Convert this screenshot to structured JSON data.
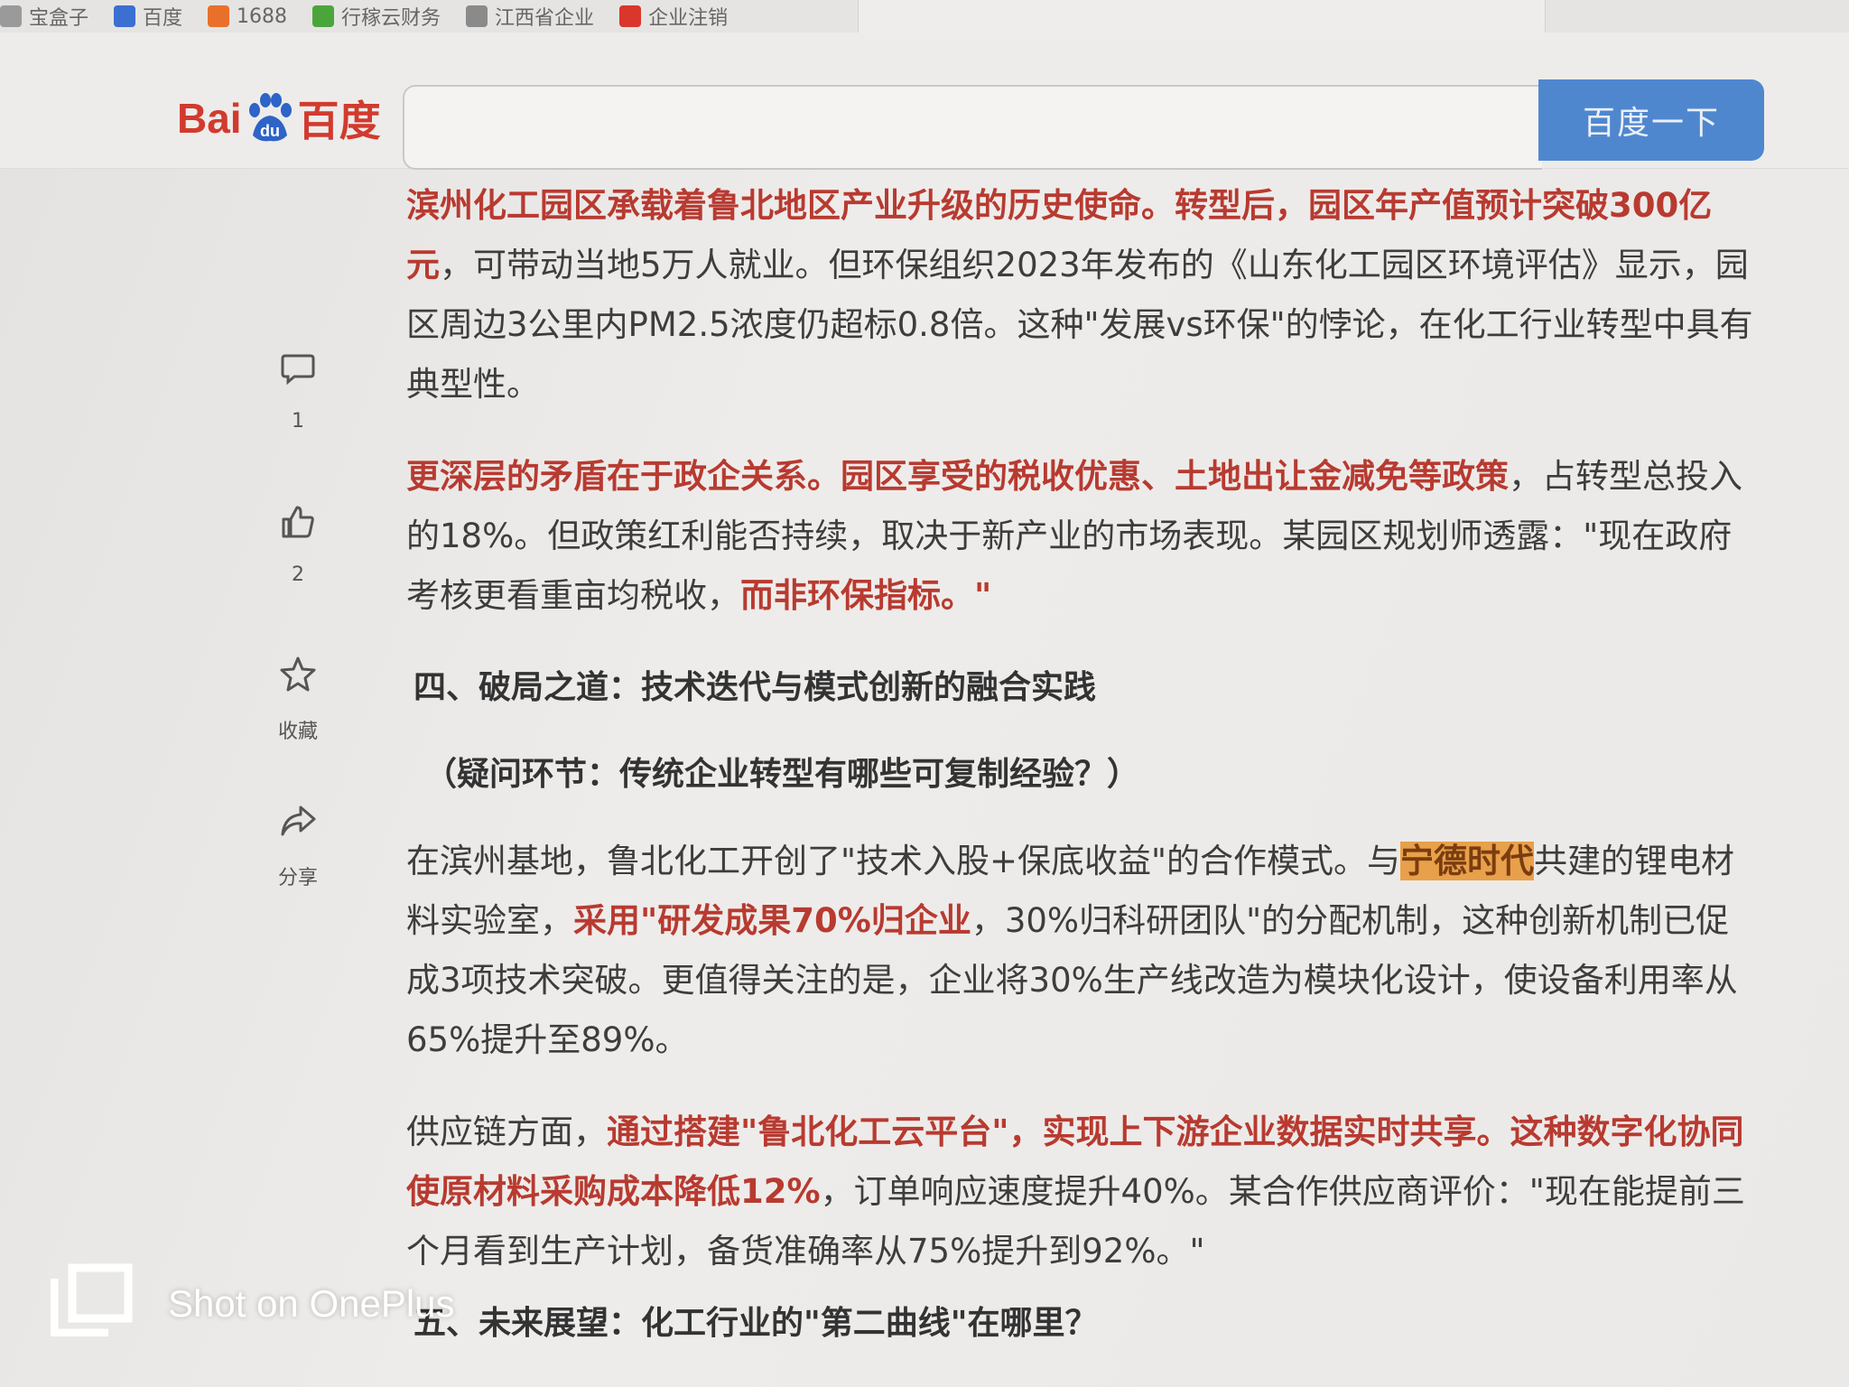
{
  "bookmarks": [
    {
      "label": "宝盒子",
      "icon": "box-icon",
      "color": "#9a9a9a"
    },
    {
      "label": "百度",
      "icon": "baidu-paw-icon",
      "color": "#3b6fd1"
    },
    {
      "label": "1688",
      "icon": "1688-icon",
      "color": "#e8702a"
    },
    {
      "label": "行稼云财务",
      "icon": "finance-icon",
      "color": "#4aa63a"
    },
    {
      "label": "江西省企业",
      "icon": "globe-icon",
      "color": "#8a8a8a"
    },
    {
      "label": "企业注销",
      "icon": "emblem-icon",
      "color": "#d9372b"
    }
  ],
  "header": {
    "logo_text_left": "Bai",
    "logo_text_mid": "du",
    "logo_text_right": "百度",
    "search_value": "",
    "search_button": "百度一下",
    "accent": "#4f87cf",
    "logo_color": "#d23a2e"
  },
  "rail": {
    "comment_count": "1",
    "like_count": "2",
    "favorite_label": "收藏",
    "share_label": "分享"
  },
  "article": {
    "p1": [
      {
        "t": "滨州化工园区承载着鲁北地区产业升级的历史使命。转型后，园区年产值预计突破300亿元",
        "s": "red"
      },
      {
        "t": "，可带动当地5万人就业。但环保组织2023年发布的《山东化工园区环境评估》显示，园区周边3公里内PM2.5浓度仍超标0.8倍。这种\"发展vs环保\"的悖论，在化工行业转型中具有典型性。",
        "s": ""
      }
    ],
    "p2": [
      {
        "t": "更深层的矛盾在于政企关系。园区享受的税收优惠、土地出让金减免等政策",
        "s": "red"
      },
      {
        "t": "，占转型总投入的18%。但政策红利能否持续，取决于新产业的市场表现。某园区规划师透露：\"现在政府考核更看重亩均税收，",
        "s": ""
      },
      {
        "t": "而非环保指标。\"",
        "s": "red"
      }
    ],
    "heading4": "四、破局之道：技术迭代与模式创新的融合实践",
    "question": "（疑问环节：传统企业转型有哪些可复制经验？）",
    "p3": [
      {
        "t": "在滨州基地，鲁北化工开创了\"技术入股+保底收益\"的合作模式。与",
        "s": ""
      },
      {
        "t": "宁德时代",
        "s": "hl"
      },
      {
        "t": "共建的锂电材料实验室，",
        "s": ""
      },
      {
        "t": "采用\"研发成果70%归企业",
        "s": "red"
      },
      {
        "t": "，30%归科研团队\"的分配机制，这种创新机制已促成3项技术突破。更值得关注的是，企业将30%生产线改造为模块化设计，使设备利用率从65%提升至89%。",
        "s": ""
      }
    ],
    "p4": [
      {
        "t": "供应链方面，",
        "s": ""
      },
      {
        "t": "通过搭建\"鲁北化工云平台\"，实现上下游企业数据实时共享。这种数字化协同使原材料采购成本降低12%",
        "s": "red"
      },
      {
        "t": "，订单响应速度提升40%。某合作供应商评价：\"现在能提前三个月看到生产计划，备货准确率从75%提升到92%。\"",
        "s": ""
      }
    ],
    "heading5": "五、未来展望：化工行业的\"第二曲线\"在哪里？"
  },
  "watermark": {
    "text": "Shot on OnePlus"
  }
}
